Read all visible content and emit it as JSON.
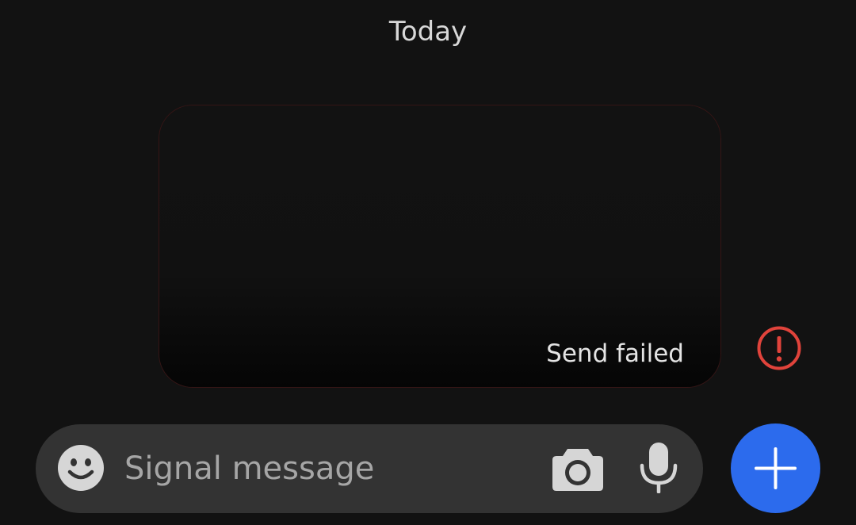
{
  "conversation": {
    "date_header": "Today",
    "message": {
      "status_text": "Send failed",
      "status_icon": "alert-circle-icon",
      "status_color": "#e0433b"
    }
  },
  "composer": {
    "placeholder": "Signal message",
    "value": "",
    "icons": {
      "emoji": "emoji-icon",
      "camera": "camera-icon",
      "microphone": "mic-icon"
    }
  },
  "attach_button": {
    "icon": "plus-icon",
    "color": "#2c6bed"
  },
  "theme": {
    "background": "#121212",
    "composer_background": "#333333",
    "icon_color": "#d6d6d6"
  }
}
